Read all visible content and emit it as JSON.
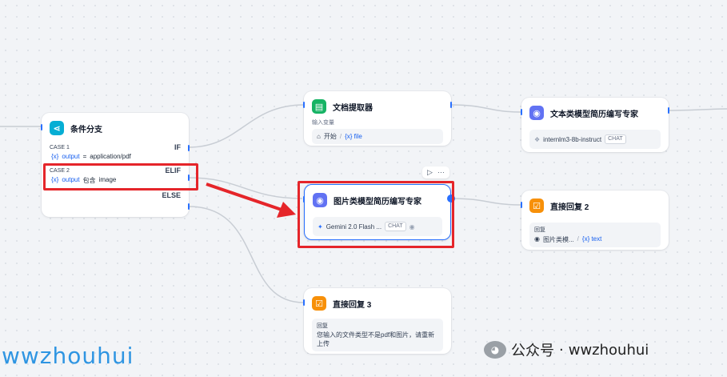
{
  "nodes": {
    "ifelse": {
      "title": "条件分支",
      "case1": {
        "label": "CASE 1",
        "keyword": "IF",
        "var": "{x}",
        "field": "output",
        "op": "=",
        "value": "application/pdf"
      },
      "case2": {
        "label": "CASE 2",
        "keyword": "ELIF",
        "var": "{x}",
        "field": "output",
        "op": "包含",
        "value": "image"
      },
      "else_label": "ELSE"
    },
    "doc_extractor": {
      "title": "文档提取器",
      "field_label": "输入变量",
      "source": "开始",
      "sep": "/",
      "var": "{x} file"
    },
    "text_llm": {
      "title": "文本类模型简历编写专家",
      "model": "internlm3-8b-instruct",
      "badge": "CHAT"
    },
    "image_llm": {
      "title": "图片类模型简历编写专家",
      "model": "Gemini 2.0 Flash ...",
      "badge": "CHAT"
    },
    "reply2": {
      "title": "直接回复 2",
      "field_label": "回复",
      "source": "图片类模...",
      "sep": "/",
      "var": "{x} text"
    },
    "reply3": {
      "title": "直接回复 3",
      "field_label": "回复",
      "text": "您输入的文件类型不是pdf和图片，请重新上传"
    }
  },
  "toolbar": {
    "play": "▷",
    "more": "···"
  },
  "watermark": {
    "left": "wwzhouhui",
    "right_prefix": "公众号",
    "right_sep": "·",
    "right_name": "wwzhouhui"
  },
  "colors": {
    "accent": "#2970ff",
    "highlight": "#e5252a",
    "llm": "#6172f3",
    "reply": "#f79009",
    "ifelse": "#06aed4",
    "doc": "#16b364"
  }
}
